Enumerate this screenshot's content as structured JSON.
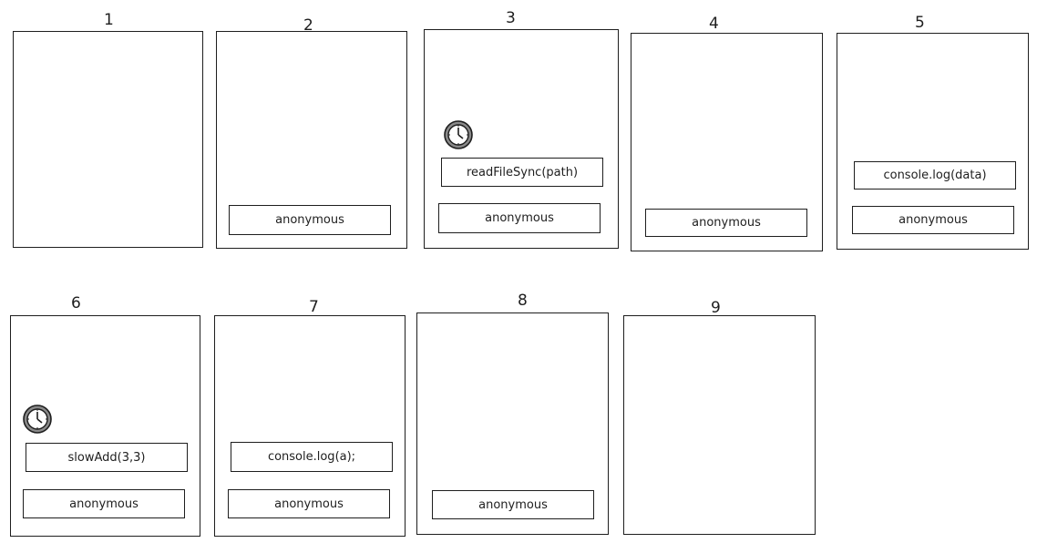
{
  "frames": [
    {
      "number": "1"
    },
    {
      "number": "2",
      "stack": [
        "anonymous"
      ]
    },
    {
      "number": "3",
      "stack": [
        "readFileSync(path)",
        "anonymous"
      ],
      "icon": "clock-icon"
    },
    {
      "number": "4",
      "stack": [
        "anonymous"
      ]
    },
    {
      "number": "5",
      "stack": [
        "console.log(data)",
        "anonymous"
      ]
    },
    {
      "number": "6",
      "stack": [
        "slowAdd(3,3)",
        "anonymous"
      ],
      "icon": "clock-icon"
    },
    {
      "number": "7",
      "stack": [
        "console.log(a);",
        "anonymous"
      ]
    },
    {
      "number": "8",
      "stack": [
        "anonymous"
      ]
    },
    {
      "number": "9"
    }
  ]
}
